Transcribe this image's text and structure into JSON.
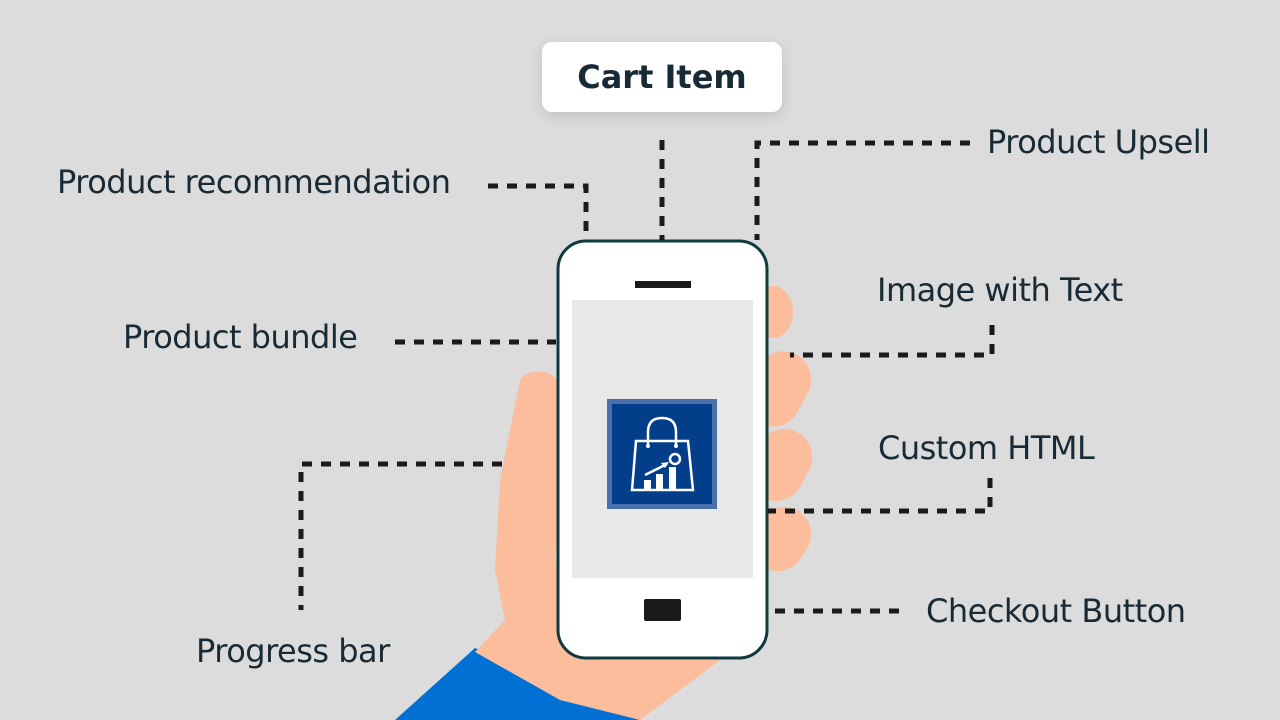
{
  "title": "Cart Item",
  "labels": {
    "product_recommendation": "Product recommendation",
    "product_upsell": "Product Upsell",
    "product_bundle": "Product bundle",
    "image_with_text": "Image with Text",
    "custom_html": "Custom HTML",
    "progress_bar": "Progress bar",
    "checkout_button": "Checkout Button"
  },
  "icons": {
    "center": "shopping-bag-growth-icon"
  },
  "colors": {
    "background": "#dcdcdc",
    "text": "#172a35",
    "connector": "#1a1a1a",
    "phone_outline": "#0f3a40",
    "phone_body": "#ffffff",
    "screen": "#e8e8e8",
    "skin": "#fbbd9b",
    "sleeve": "#0070d4",
    "icon_bg": "#023e8a",
    "icon_border": "#4a70ab"
  }
}
